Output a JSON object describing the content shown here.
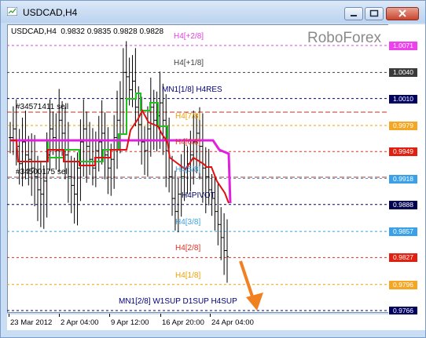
{
  "window": {
    "title": "USDCAD,H4"
  },
  "chart_info": "USDCAD,H4  0.9832 0.9835 0.9828 0.9828",
  "brand": "RoboForex",
  "levels": [
    {
      "label": "H4[+2/8]",
      "price": "1.0071",
      "color": "#e040e0",
      "box_bg": "#ee40ee",
      "box_fg": "#ffffff"
    },
    {
      "label": "H4[+1/8]",
      "price": "1.0040",
      "color": "#404040",
      "box_bg": "#3a3a3a",
      "box_fg": "#ffffff"
    },
    {
      "label": "MN1[1/8] H4RES",
      "price": "1.0010",
      "color": "#000080",
      "box_bg": "#000060",
      "box_fg": "#ffffff"
    },
    {
      "label": "H4[7/8]",
      "price": "0.9979",
      "color": "#f0a000",
      "box_bg": "#f5a623",
      "box_fg": "#ffffff"
    },
    {
      "label": "H4[6/8]",
      "price": "0.9949",
      "color": "#e03020",
      "box_bg": "#e02010",
      "box_fg": "#ffffff"
    },
    {
      "label": "H4[5/8]",
      "price": "0.9918",
      "color": "#3aa0e0",
      "box_bg": "#3aa0e8",
      "box_fg": "#ffffff"
    },
    {
      "label": "H4PIVOT",
      "price": "0.9888",
      "color": "#000060",
      "box_bg": "#000050",
      "box_fg": "#ffffff"
    },
    {
      "label": "H4[3/8]",
      "price": "0.9857",
      "color": "#3aa0e0",
      "box_bg": "#3aa0e8",
      "box_fg": "#ffffff"
    },
    {
      "label": "H4[2/8]",
      "price": "0.9827",
      "color": "#e03020",
      "box_bg": "#e02010",
      "box_fg": "#ffffff"
    },
    {
      "label": "H4[1/8]",
      "price": "0.9796",
      "color": "#f0a000",
      "box_bg": "#f5a623",
      "box_fg": "#ffffff"
    },
    {
      "label": "MN1[2/8] W1SUP D1SUP H4SUP",
      "price": "0.9766",
      "color": "#000080",
      "box_bg": "#000060",
      "box_fg": "#ffffff"
    }
  ],
  "orders": [
    {
      "label": "#34571411 sell"
    },
    {
      "label": "#34500175 sell"
    }
  ],
  "time_labels": [
    "23 Mar 2012",
    "2 Apr 04:00",
    "9 Apr 12:00",
    "16 Apr 20:00",
    "24 Apr 04:00"
  ],
  "chart_data": {
    "type": "ohlc",
    "symbol": "USDCAD",
    "timeframe": "H4",
    "ylim": [
      0.9766,
      1.0081
    ],
    "last_ohlc": {
      "open": 0.9832,
      "high": 0.9835,
      "low": 0.9828,
      "close": 0.9828
    },
    "approx_close_series": [
      0.9965,
      0.9975,
      0.9955,
      0.9935,
      0.996,
      0.9945,
      0.994,
      0.993,
      0.992,
      0.9905,
      0.99,
      0.9915,
      0.9945,
      0.9975,
      0.9965,
      0.995,
      0.9985,
      0.997,
      0.9945,
      0.992,
      0.991,
      0.99,
      0.993,
      0.996,
      0.9975,
      0.9955,
      0.994,
      0.993,
      0.995,
      0.996,
      0.997,
      0.9945,
      0.993,
      0.994,
      0.9965,
      0.9985,
      1.001,
      1.004,
      1.0035,
      1.002,
      1.003,
      1.0,
      0.998,
      0.996,
      0.995,
      0.9975,
      1.0,
      0.9985,
      0.999,
      1.0005,
      0.9985,
      0.995,
      0.992,
      0.9895,
      0.988,
      0.99,
      0.992,
      0.993,
      0.9935,
      0.9945,
      0.996,
      0.997,
      0.9955,
      0.993,
      0.992,
      0.9905,
      0.9895,
      0.988,
      0.9865,
      0.985,
      0.9835,
      0.9828
    ]
  },
  "forecast_arrow": {
    "color": "#f08020"
  }
}
